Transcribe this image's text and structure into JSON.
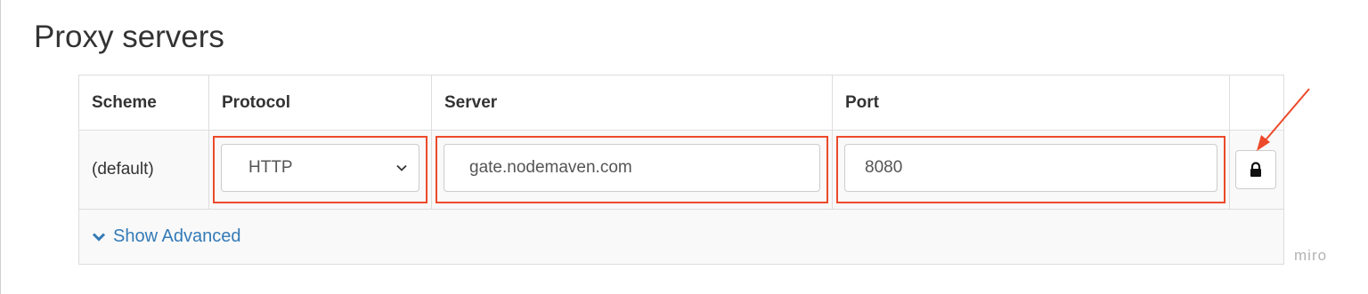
{
  "page_title": "Proxy servers",
  "table": {
    "headers": {
      "scheme": "Scheme",
      "protocol": "Protocol",
      "server": "Server",
      "port": "Port"
    },
    "row": {
      "scheme": "(default)",
      "protocol": "HTTP",
      "server": "gate.nodemaven.com",
      "port": "8080"
    },
    "show_advanced": "Show Advanced"
  },
  "watermark": "miro",
  "icons": {
    "lock": "lock-icon",
    "chevron_down": "chevron-down-icon",
    "advanced_chevron": "chevron-down-icon",
    "annotation": "arrow-icon"
  },
  "colors": {
    "highlight": "#ec4a2a",
    "link": "#337ab7"
  }
}
